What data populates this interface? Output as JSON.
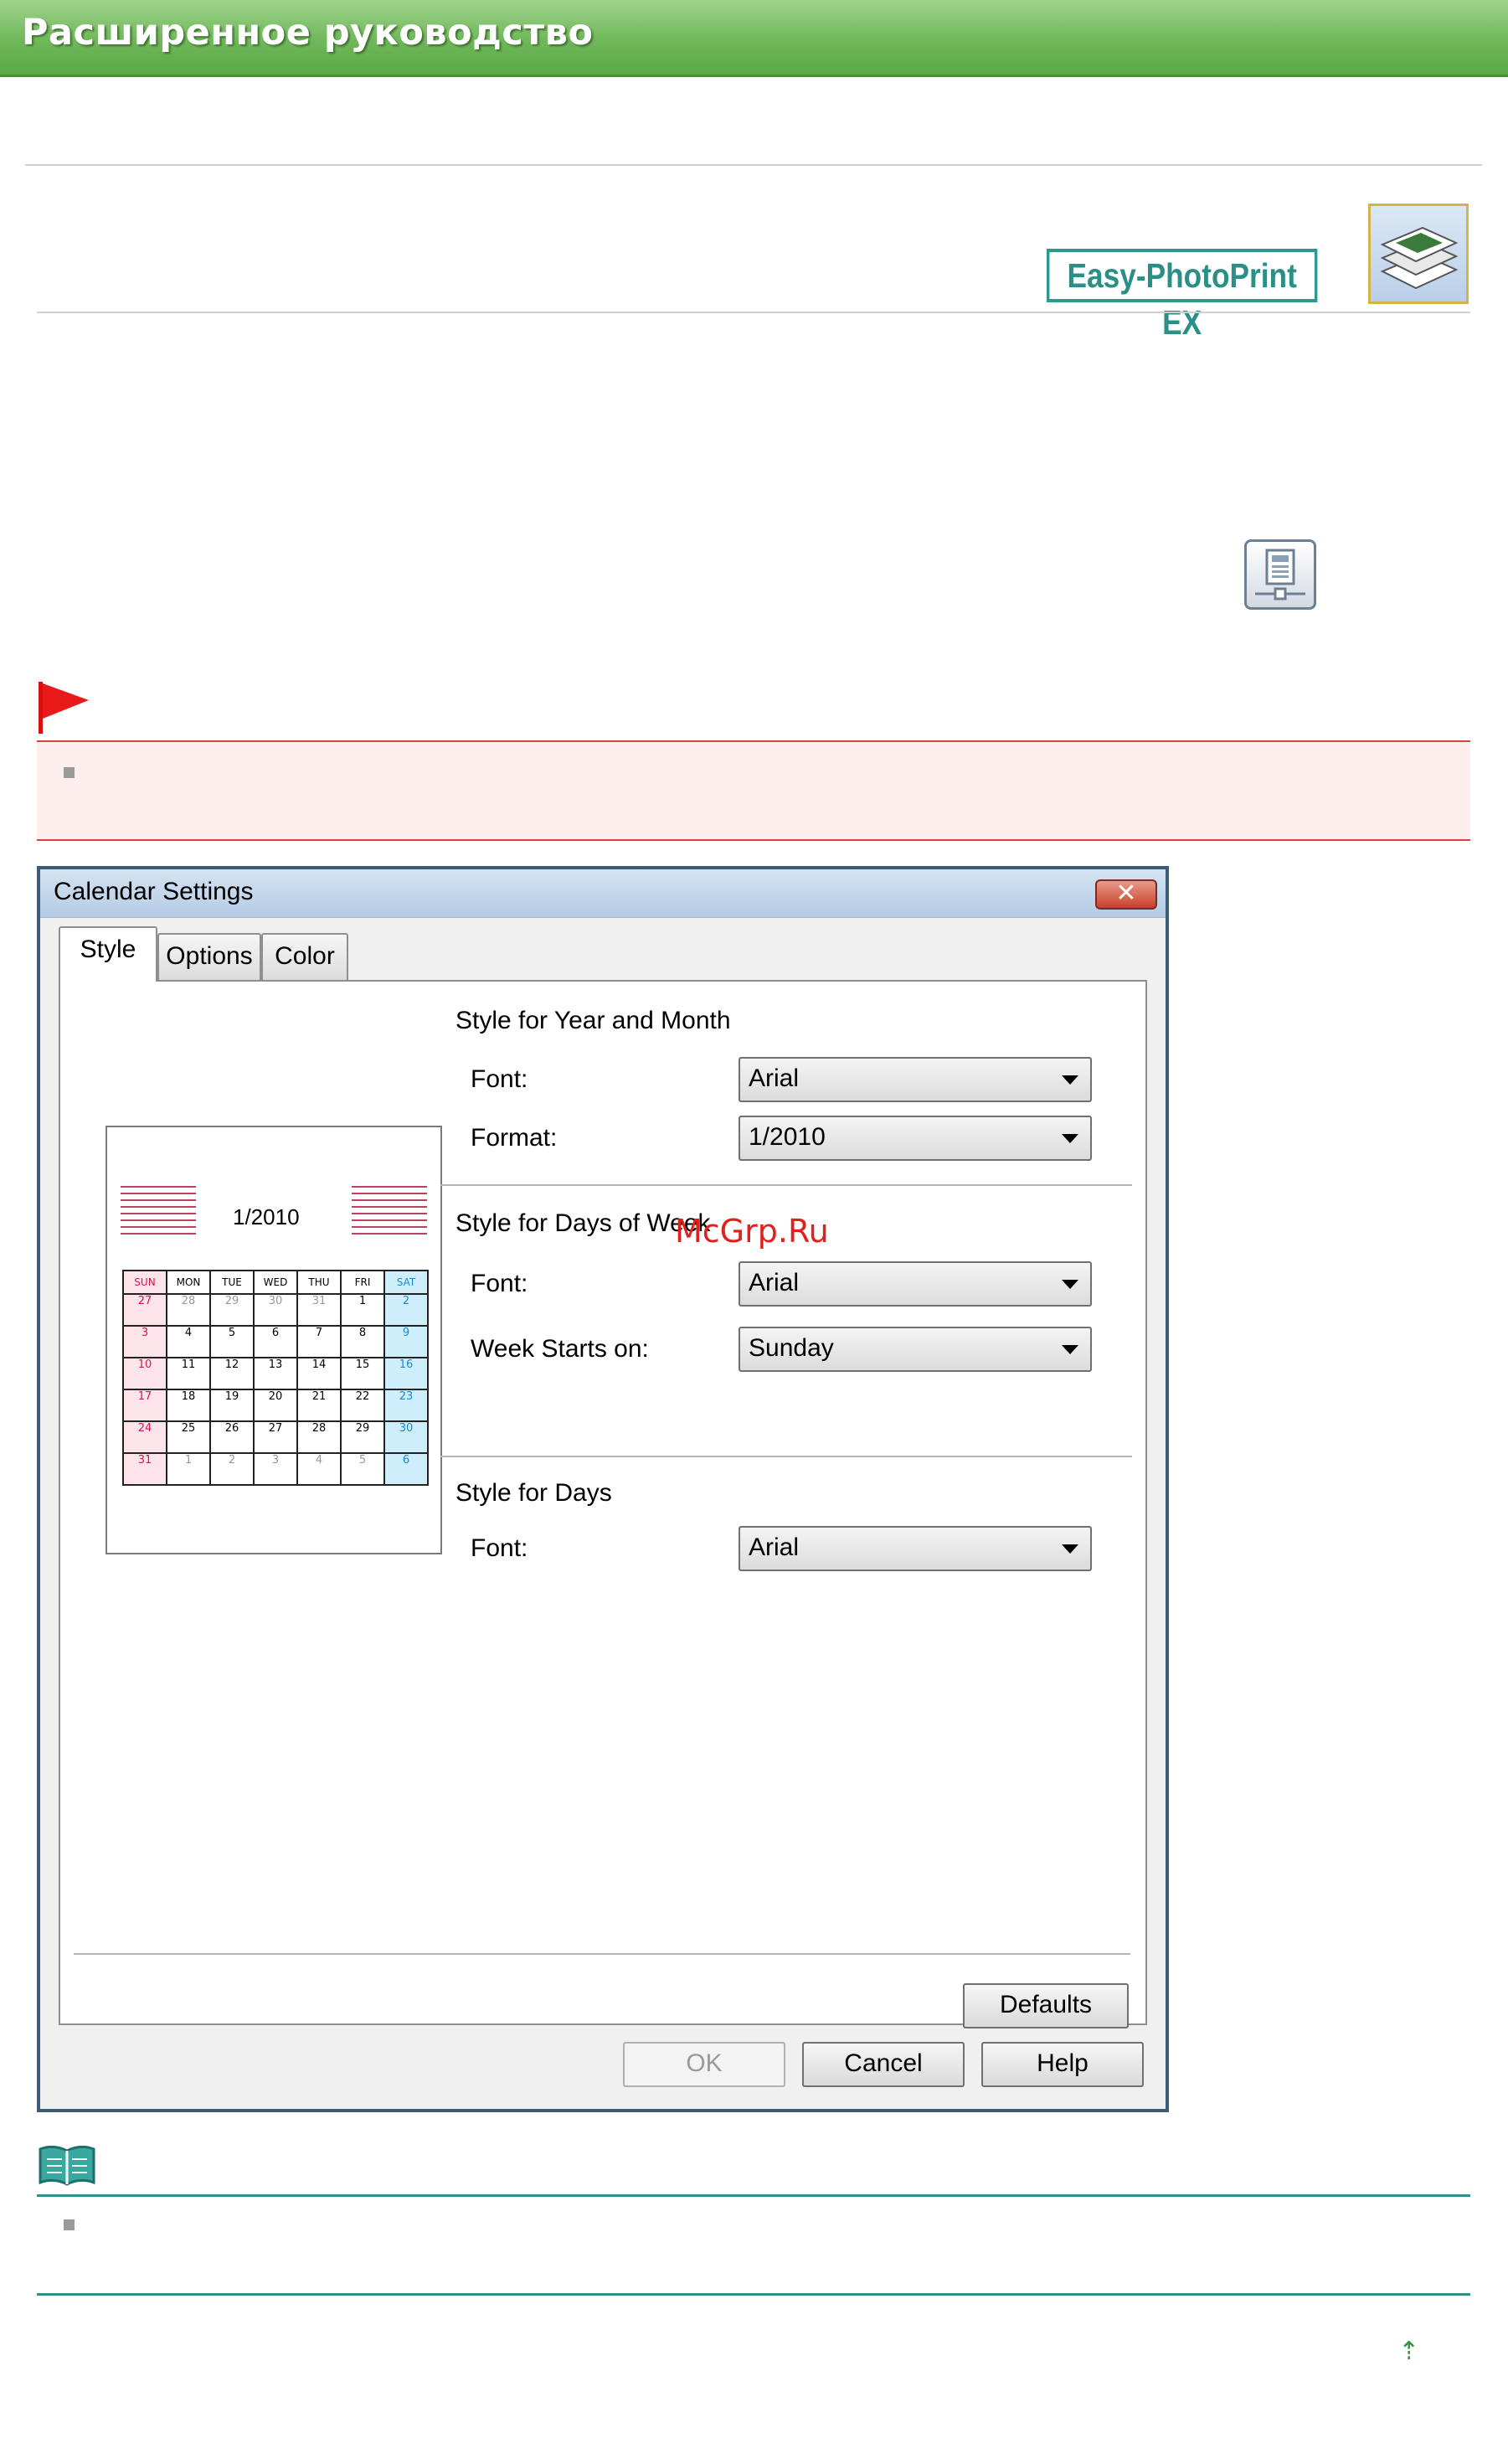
{
  "header": {
    "title": "Расширенное руководство"
  },
  "product_logo": {
    "text": "Easy-PhotoPrint EX"
  },
  "watermark": "McGrp.Ru",
  "dialog": {
    "title": "Calendar Settings",
    "close_symbol": "✕",
    "tabs": [
      {
        "label": "Style",
        "active": true
      },
      {
        "label": "Options",
        "active": false
      },
      {
        "label": "Color",
        "active": false
      }
    ],
    "preview": {
      "month_label": "1/2010",
      "weekday_headers": [
        "SUN",
        "MON",
        "TUE",
        "WED",
        "THU",
        "FRI",
        "SAT"
      ],
      "weeks": [
        [
          "27",
          "28",
          "29",
          "30",
          "31",
          "1",
          "2"
        ],
        [
          "3",
          "4",
          "5",
          "6",
          "7",
          "8",
          "9"
        ],
        [
          "10",
          "11",
          "12",
          "13",
          "14",
          "15",
          "16"
        ],
        [
          "17",
          "18",
          "19",
          "20",
          "21",
          "22",
          "23"
        ],
        [
          "24",
          "25",
          "26",
          "27",
          "28",
          "29",
          "30"
        ],
        [
          "31",
          "1",
          "2",
          "3",
          "4",
          "5",
          "6"
        ]
      ]
    },
    "year_month": {
      "section_title": "Style for Year and Month",
      "font_label": "Font:",
      "font_value": "Arial",
      "format_label": "Format:",
      "format_value": "1/2010"
    },
    "days_of_week": {
      "section_title": "Style for Days of Week",
      "font_label": "Font:",
      "font_value": "Arial",
      "week_starts_label": "Week Starts on:",
      "week_starts_value": "Sunday"
    },
    "days": {
      "section_title": "Style for Days",
      "font_label": "Font:",
      "font_value": "Arial"
    },
    "buttons": {
      "defaults": "Defaults",
      "ok": "OK",
      "cancel": "Cancel",
      "help": "Help"
    }
  },
  "page_top_symbol": "⇡",
  "colors": {
    "header_green": "#6fb85a",
    "important_red": "#d84040",
    "note_teal": "#2f8f8a",
    "logo_teal": "#2a9a8f"
  }
}
